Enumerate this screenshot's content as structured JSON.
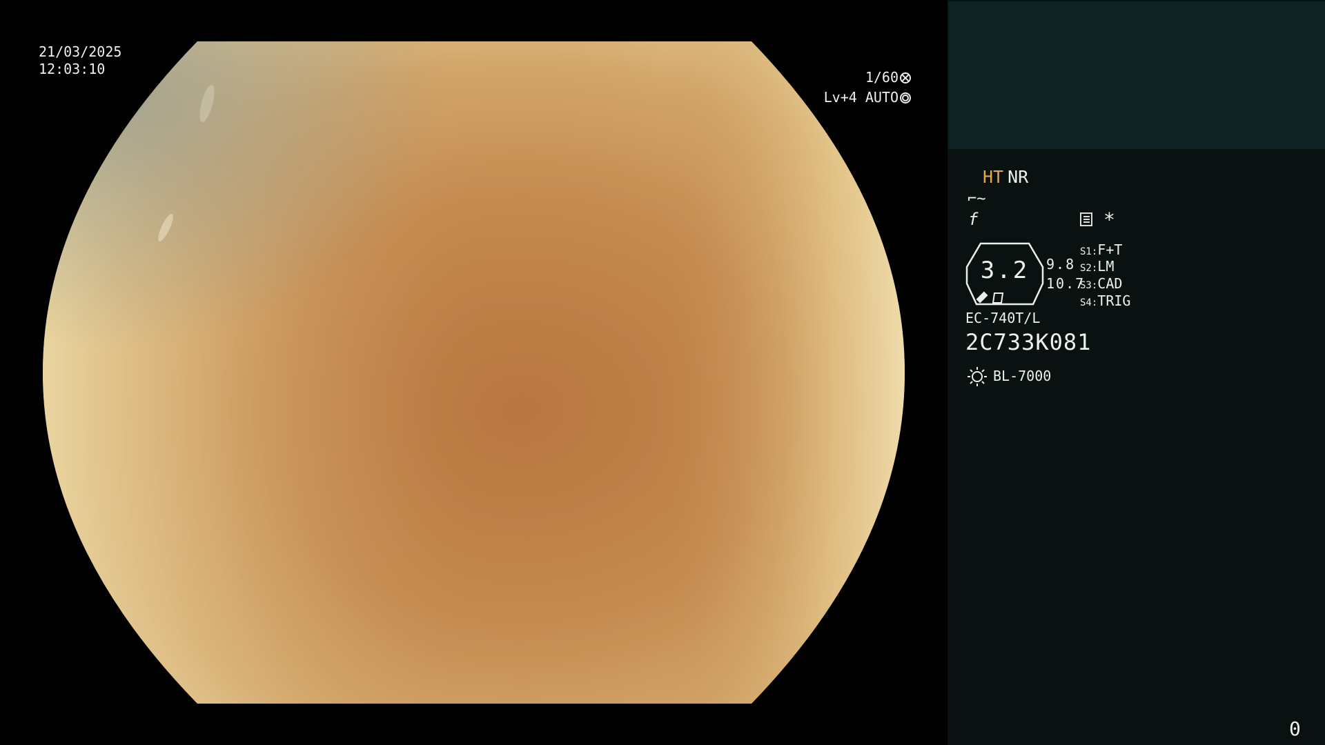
{
  "scope_view": {
    "date": "21/03/2025",
    "time": "12:03:10",
    "shutter_speed": "1/60",
    "shutter_icon": "shutter-icon",
    "level_mode": "Lv+4 AUTO",
    "iris_icon": "iris-icon"
  },
  "info_panel": {
    "mode_ht": "HT",
    "mode_nr": "NR",
    "enhance_icon": "structure-enhance-icon",
    "enhance_glyph": "⌐~",
    "gamma_icon": "gamma-icon",
    "gamma_glyph": "f",
    "menu_icon": "menu-icon",
    "asterisk": "*",
    "scope_channel_value": "3.2",
    "diameter_1": "9.8",
    "diameter_2": "10.7",
    "switches": [
      {
        "key": "S1:",
        "value": "F+T"
      },
      {
        "key": "S2:",
        "value": "LM"
      },
      {
        "key": "S3:",
        "value": "CAD"
      },
      {
        "key": "S4:",
        "value": "TRIG"
      }
    ],
    "scope_model": "EC-740T/L",
    "scope_serial": "2C733K081",
    "light_source_icon": "light-source-icon",
    "light_source_model": "BL-7000",
    "frame_counter": "0"
  },
  "colors": {
    "ht_accent": "#e8a64c",
    "panel_bg": "#091211",
    "thumbnail_bg": "#0e2224"
  }
}
